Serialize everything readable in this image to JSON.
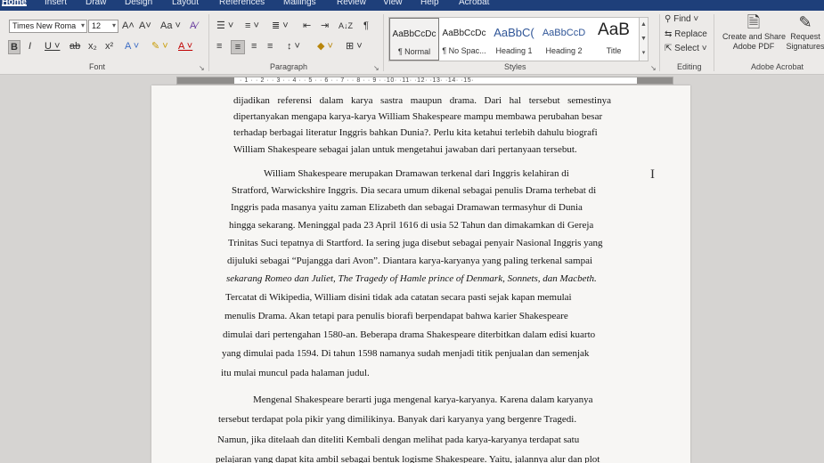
{
  "tabs": [
    "Home",
    "Insert",
    "Draw",
    "Design",
    "Layout",
    "References",
    "Mailings",
    "Review",
    "View",
    "Help",
    "Acrobat"
  ],
  "font": {
    "name": "Times New Roma",
    "size": "12",
    "grow": "A˄",
    "shrink": "A˅",
    "case": "Aa ˅",
    "clear": "A⁄",
    "bold": "B",
    "italic": "I",
    "underline": "U ˅",
    "strike": "ab",
    "sub": "x₂",
    "sup": "x²",
    "effects": "A ˅",
    "highlight": "✎ ˅",
    "color": "A ˅",
    "label": "Font"
  },
  "paragraph": {
    "bullets": "☰ ˅",
    "numbering": "≡ ˅",
    "multilevel": "≣ ˅",
    "decrease_indent": "⇤",
    "increase_indent": "⇥",
    "sort": "A↓Z",
    "show_marks": "¶",
    "align_left": "≡",
    "center": "≡",
    "align_right": "≡",
    "justify": "≡",
    "spacing": "↕ ˅",
    "shading": "◆ ˅",
    "borders": "⊞ ˅",
    "label": "Paragraph"
  },
  "styles": {
    "items": [
      {
        "sample": "AaBbCcDc",
        "name": "¶ Normal"
      },
      {
        "sample": "AaBbCcDc",
        "name": "¶ No Spac..."
      },
      {
        "sample": "AaBbC(",
        "name": "Heading 1"
      },
      {
        "sample": "AaBbCcD",
        "name": "Heading 2"
      },
      {
        "sample": "AaB",
        "name": "Title"
      }
    ],
    "label": "Styles"
  },
  "editing": {
    "find": "Find ˅",
    "replace": "Replace",
    "select": "Select ˅",
    "label": "Editing"
  },
  "acrobat": {
    "create_line1": "Create and Share",
    "create_line2": "Adobe PDF",
    "request_line1": "Request",
    "request_line2": "Signatures",
    "label": "Adobe Acrobat"
  },
  "ruler": {
    "ticks": "· 1 · · 2 · · 3 · · 4 · · 5 · · 6 · · 7 · · 8 · · 9 · ·10· ·11· ·12· ·13· ·14· ·15·"
  },
  "document": {
    "lines": [
      "dijadikan  referensi  dalam  karya  sastra  maupun  drama.  Dari  hal  tersebut  semestinya",
      "dipertanyakan mengapa karya-karya William Shakespeare mampu membawa perubahan besar",
      "terhadap berbagai literatur Inggris bahkan Dunia?. Perlu kita ketahui terlebih dahulu biografi",
      "William Shakespeare sebagai jalan untuk mengetahui jawaban dari pertanyaan tersebut.",
      "William  Shakespeare  merupakan  Dramawan  terkenal  dari  Inggris  kelahiran  di",
      "Stratford, Warwickshire Inggris. Dia secara umum dikenal sebagai penulis Drama terhebat di",
      "Inggris pada masanya yaitu zaman Elizabeth dan sebagai Dramawan termasyhur di Dunia",
      "hingga sekarang. Meninggal pada 23 April 1616 di usia 52 Tahun dan dimakamkan di Gereja",
      "Trinitas Suci tepatnya di Startford. Ia sering juga disebut sebagai penyair Nasional Inggris yang",
      "dijuluki sebagai “Pujangga dari Avon”.  Diantara karya-karyanya yang paling terkenal sampai",
      "sekarang Romeo dan Juliet, The Tragedy of Hamle  prince of Denmark, Sonnets, dan Macbeth.",
      "Tercatat di Wikipedia,  William disini tidak ada catatan secara pasti sejak kapan memulai",
      "menulis Drama.  Akan tetapi para penulis biorafi berpendapat bahwa karier Shakespeare",
      "dimulai dari pertengahan 1580-an. Beberapa drama Shakespeare diterbitkan dalam edisi kuarto",
      "yang dimulai pada 1594. Di tahun 1598 namanya sudah menjadi titik penjualan dan semenjak",
      "itu mulai muncul pada halaman judul.",
      "Mengenal Shakespeare berarti juga mengenal karya-karyanya. Karena dalam karyanya",
      "tersebut terdapat pola pikir yang dimilikinya. Banyak dari karyanya yang bergenre Tragedi.",
      "Namun, jika ditelaah dan diteliti Kembali dengan melihat pada karya-karyanya terdapat satu",
      "pelajaran yang dapat kita ambil sebagai bentuk logisme Shakespeare. Yaitu, jalannya alur dan plot"
    ]
  }
}
